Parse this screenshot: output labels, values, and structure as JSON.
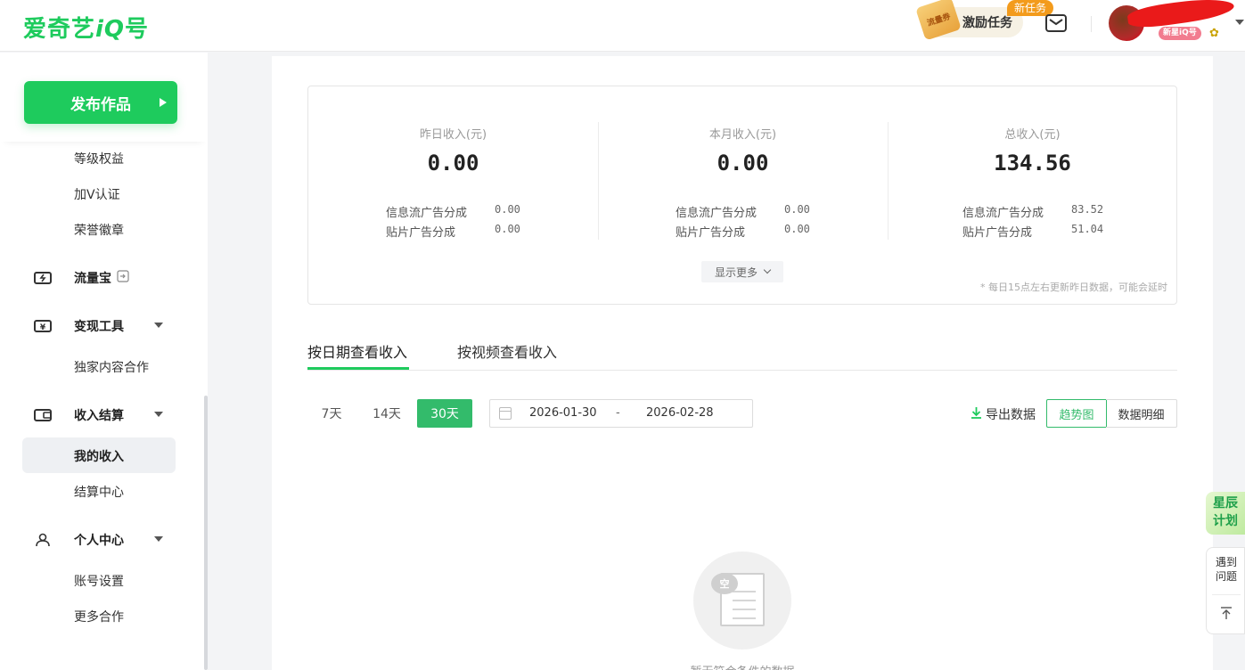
{
  "header": {
    "logo_text": "爱奇艺",
    "logo_iq": "iQ",
    "logo_suffix": "号",
    "coupon_text": "流量券",
    "task_label": "激励任务",
    "new_badge": "新任务",
    "level_badge": "新星iQ号"
  },
  "sidebar": {
    "publish_label": "发布作品",
    "items": [
      {
        "label": "等级权益"
      },
      {
        "label": "加V认证"
      },
      {
        "label": "荣誉徽章"
      }
    ],
    "groups": [
      {
        "label": "流量宝",
        "icon": "lightning-card-icon"
      },
      {
        "label": "变现工具",
        "icon": "yen-card-icon"
      },
      {
        "label": "收入结算",
        "icon": "wallet-icon"
      },
      {
        "label": "个人中心",
        "icon": "person-icon"
      }
    ],
    "sub_monetize": [
      "独家内容合作"
    ],
    "sub_income": [
      "我的收入",
      "结算中心"
    ],
    "sub_personal": [
      "账号设置",
      "更多合作"
    ],
    "active_item": "我的收入"
  },
  "summary": {
    "columns": [
      {
        "title": "昨日收入(元)",
        "total": "0.00",
        "feed_label": "信息流广告分成",
        "feed_value": "0.00",
        "preroll_label": "贴片广告分成",
        "preroll_value": "0.00"
      },
      {
        "title": "本月收入(元)",
        "total": "0.00",
        "feed_label": "信息流广告分成",
        "feed_value": "0.00",
        "preroll_label": "贴片广告分成",
        "preroll_value": "0.00"
      },
      {
        "title": "总收入(元)",
        "total": "134.56",
        "feed_label": "信息流广告分成",
        "feed_value": "83.52",
        "preroll_label": "贴片广告分成",
        "preroll_value": "51.04"
      }
    ],
    "show_more": "显示更多",
    "note": "* 每日15点左右更新昨日数据，可能会延时"
  },
  "tabs": {
    "by_date": "按日期查看收入",
    "by_video": "按视频查看收入"
  },
  "filters": {
    "range_7": "7天",
    "range_14": "14天",
    "range_30": "30天",
    "active_range": "30天",
    "date_start": "2026-01-30",
    "date_sep": "-",
    "date_end": "2026-02-28",
    "export_label": "导出数据",
    "view_trend": "趋势图",
    "view_detail": "数据明细",
    "active_view": "趋势图"
  },
  "empty": {
    "bubble": "空",
    "text": "暂无符合条件的数据"
  },
  "floating": {
    "star_plan_line1": "星辰",
    "star_plan_line2": "计划",
    "help_line1": "遇到",
    "help_line2": "问题"
  },
  "colors": {
    "brand": "#1ecb5d",
    "active_green": "#33bb6b",
    "badge_orange": "#f39b1c"
  }
}
